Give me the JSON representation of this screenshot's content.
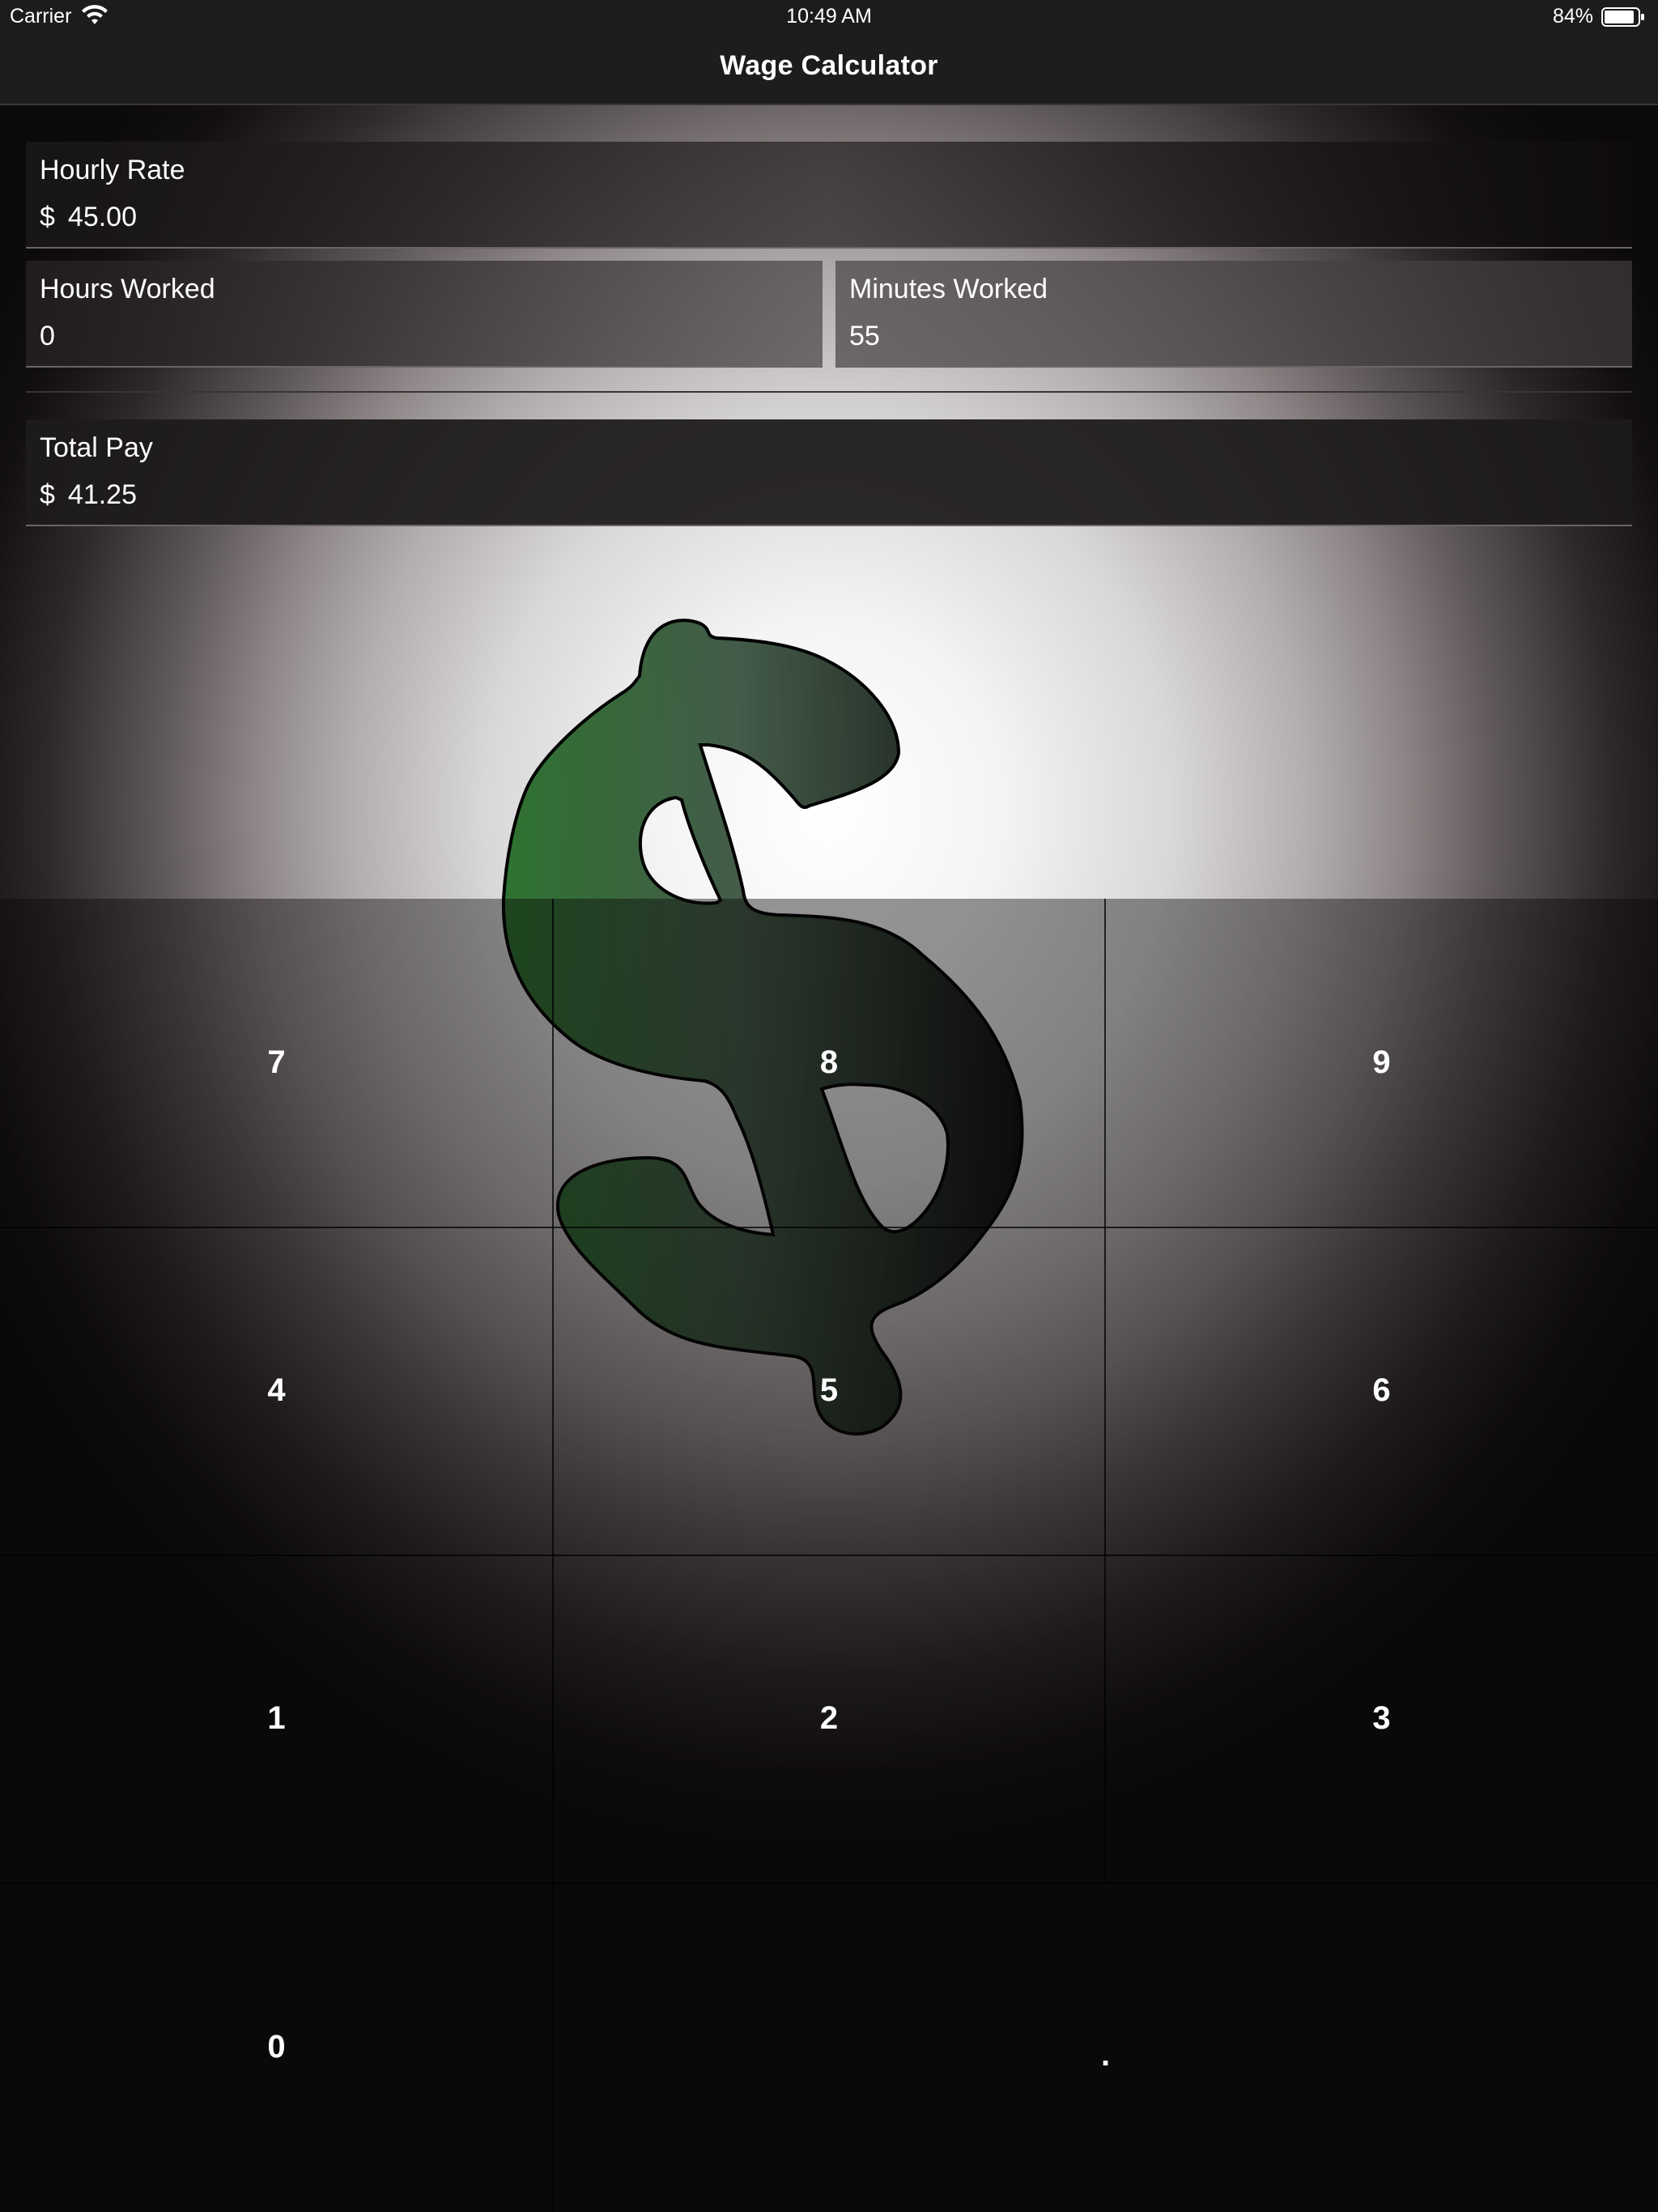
{
  "status_bar": {
    "carrier": "Carrier",
    "time": "10:49 AM",
    "battery_percent": "84%",
    "wifi_icon": "wifi-icon",
    "battery_icon": "battery-icon"
  },
  "nav": {
    "title": "Wage Calculator"
  },
  "fields": {
    "hourly_rate": {
      "label": "Hourly Rate",
      "currency": "$",
      "value": "45.00"
    },
    "hours_worked": {
      "label": "Hours Worked",
      "value": "0"
    },
    "minutes_worked": {
      "label": "Minutes Worked",
      "value": "55"
    },
    "total_pay": {
      "label": "Total Pay",
      "currency": "$",
      "value": "41.25"
    }
  },
  "background_graphic": {
    "icon": "dollar-sign-icon",
    "colors": {
      "top": "#2a6a2a",
      "bottom": "#1a1a1a"
    }
  },
  "keypad": {
    "keys": [
      "7",
      "8",
      "9",
      "4",
      "5",
      "6",
      "1",
      "2",
      "3",
      "0",
      "."
    ]
  }
}
